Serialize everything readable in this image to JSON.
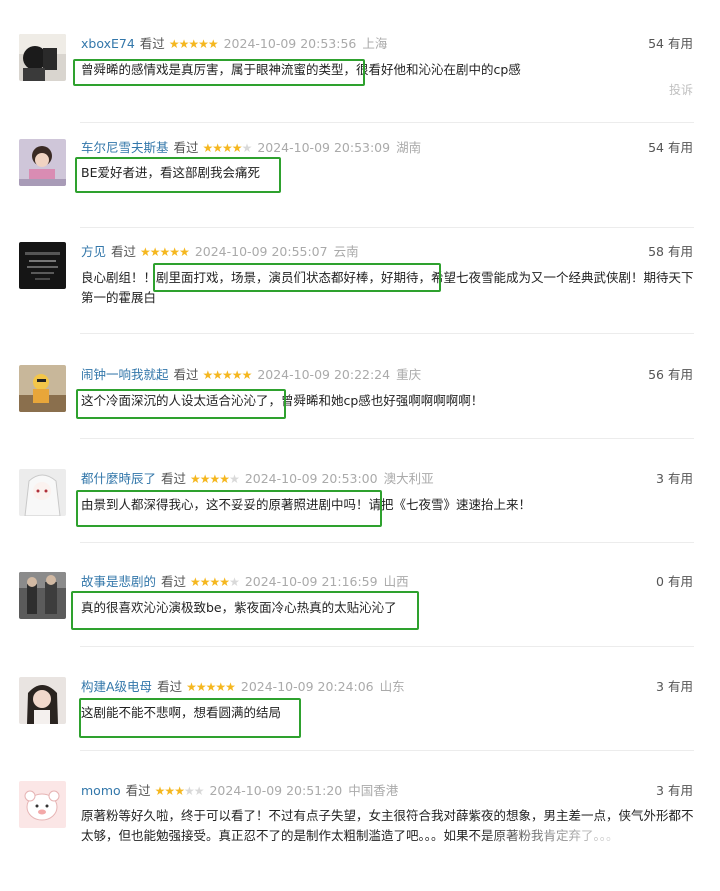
{
  "comments": [
    {
      "user": "xboxE74",
      "watched": "看过",
      "stars": 5,
      "time": "2024-10-09 20:53:56",
      "location": "上海",
      "useful_count": "54",
      "useful_label": "有用",
      "text": "曾舜晞的感情戏是真厉害，属于眼神流蜜的类型，很看好他和沁沁在剧中的cp感",
      "report": "投诉"
    },
    {
      "user": "车尔尼雪夫斯基",
      "watched": "看过",
      "stars": 4,
      "time": "2024-10-09 20:53:09",
      "location": "湖南",
      "useful_count": "54",
      "useful_label": "有用",
      "text": "BE爱好者进，看这部剧我会痛死"
    },
    {
      "user": "方见",
      "watched": "看过",
      "stars": 5,
      "time": "2024-10-09 20:55:07",
      "location": "云南",
      "useful_count": "58",
      "useful_label": "有用",
      "text": "良心剧组！！剧里面打戏，场景，演员们状态都好棒，好期待，希望七夜雪能成为又一个经典武侠剧！期待天下第一的霍展白"
    },
    {
      "user": "闹钟一响我就起",
      "watched": "看过",
      "stars": 5,
      "time": "2024-10-09 20:22:24",
      "location": "重庆",
      "useful_count": "56",
      "useful_label": "有用",
      "text": "这个冷面深沉的人设太适合沁沁了，曾舜晞和她cp感也好强啊啊啊啊啊！"
    },
    {
      "user": "都什麼時辰了",
      "watched": "看过",
      "stars": 4,
      "time": "2024-10-09 20:53:00",
      "location": "澳大利亚",
      "useful_count": "3",
      "useful_label": "有用",
      "text": "由景到人都深得我心，这不妥妥的原著照进剧中吗！请把《七夜雪》速速抬上来！"
    },
    {
      "user": "故事是悲剧的",
      "watched": "看过",
      "stars": 4,
      "time": "2024-10-09 21:16:59",
      "location": "山西",
      "useful_count": "0",
      "useful_label": "有用",
      "text": "真的很喜欢沁沁演极致be，紫夜面冷心热真的太贴沁沁了"
    },
    {
      "user": "构建A级电母",
      "watched": "看过",
      "stars": 5,
      "time": "2024-10-09 20:24:06",
      "location": "山东",
      "useful_count": "3",
      "useful_label": "有用",
      "text": "这剧能不能不悲啊，想看圆满的结局"
    },
    {
      "user": "momo",
      "watched": "看过",
      "stars": 3,
      "time": "2024-10-09 20:51:20",
      "location": "中国香港",
      "useful_count": "3",
      "useful_label": "有用",
      "text": "原著粉等好久啦，终于可以看了！不过有点子失望，女主很符合我对薛紫夜的想象，男主差一点，侠气外形都不太够，但也能勉强接受。真正忍不了的是制作太粗制滥造了吧。。。如果不是原著粉我肯定弃了。。。"
    }
  ],
  "colors": {
    "username": "#3377aa",
    "star_on": "#f5b71f",
    "star_off": "#d9d9d9",
    "highlight_box": "#2ea12e"
  }
}
